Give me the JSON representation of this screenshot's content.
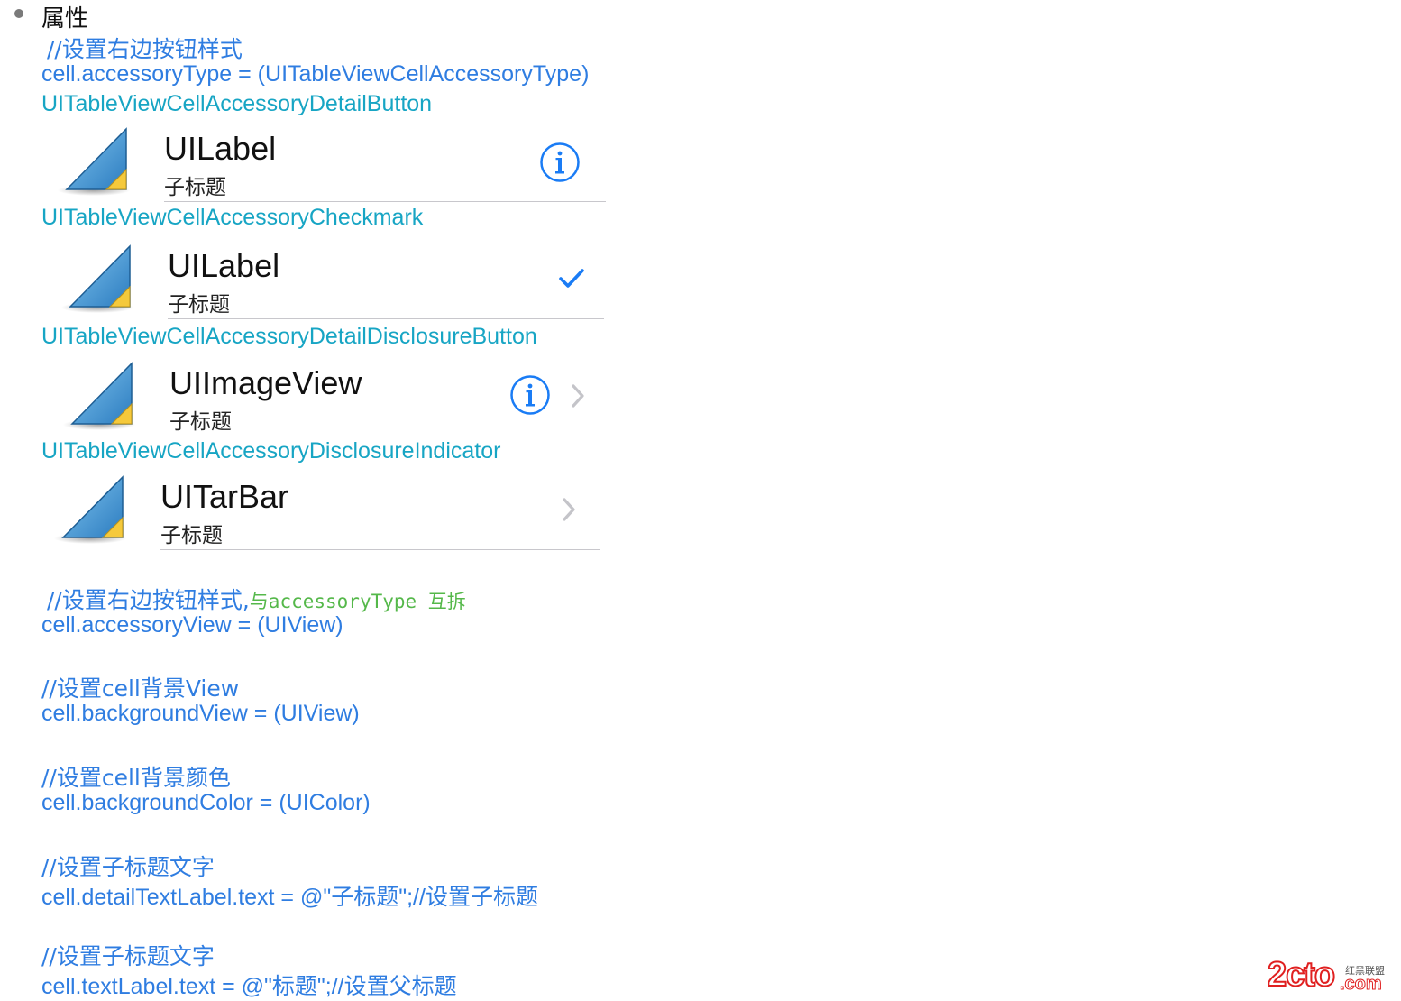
{
  "heading": "属性",
  "colors": {
    "code_blue": "#2f7de1",
    "type_cyan": "#17a5c4",
    "comment_green": "#55b84a",
    "ios_blue": "#1a7cf5",
    "chevron_gray": "#c4c4c9",
    "logo_red": "#e02020"
  },
  "section1": {
    "comment": "//设置右边按钮样式",
    "code": "cell.accessoryType = (UITableViewCellAccessoryType)"
  },
  "cells": [
    {
      "type_label": "UITableViewCellAccessoryDetailButton",
      "title": "UILabel",
      "subtitle": "子标题",
      "accessory": "info-icon"
    },
    {
      "type_label": "UITableViewCellAccessoryCheckmark",
      "title": "UILabel",
      "subtitle": "子标题",
      "accessory": "checkmark-icon"
    },
    {
      "type_label": "UITableViewCellAccessoryDetailDisclosureButton",
      "title": "UIImageView",
      "subtitle": "子标题",
      "accessory": "info-icon + chevron-right-icon"
    },
    {
      "type_label": "UITableViewCellAccessoryDisclosureIndicator",
      "title": "UITarBar",
      "subtitle": "子标题",
      "accessory": "chevron-right-icon"
    }
  ],
  "section2": {
    "comment": "//设置右边按钮样式,",
    "comment_green": "与accessoryType 互拆",
    "code": "cell.accessoryView = (UIView)"
  },
  "section3": {
    "comment": "//设置cell背景View",
    "code": "cell.backgroundView = (UIView)"
  },
  "section4": {
    "comment": "//设置cell背景颜色",
    "code": "cell.backgroundColor = (UIColor)"
  },
  "section5": {
    "comment": "//设置子标题文字",
    "code": "cell.detailTextLabel.text = @\"子标题\";//设置子标题"
  },
  "section6": {
    "comment": "//设置子标题文字",
    "code": "cell.textLabel.text = @\"标题\";//设置父标题"
  },
  "watermark": {
    "main": "2cto",
    "suffix": ".com",
    "tagline": "红黑联盟"
  }
}
